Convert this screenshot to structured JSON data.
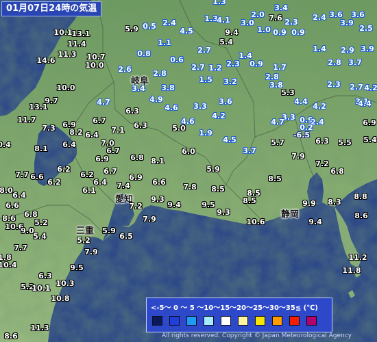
{
  "title": "01月07日24時の気温",
  "prefectures": [
    {
      "id": "gifu",
      "name": "岐阜"
    },
    {
      "id": "aichi",
      "name": "愛知"
    },
    {
      "id": "mie",
      "name": "三重"
    },
    {
      "id": "shizuoka",
      "name": "静岡"
    }
  ],
  "temperatures": [
    {
      "id": "t01",
      "value": "1.3",
      "kind": "cold"
    },
    {
      "id": "t02",
      "value": "2.0",
      "kind": "cold"
    },
    {
      "id": "t03",
      "value": "7.6",
      "kind": "hot"
    },
    {
      "id": "t04",
      "value": "3.4",
      "kind": "cold"
    },
    {
      "id": "t05",
      "value": "2.4",
      "kind": "cold"
    },
    {
      "id": "t06",
      "value": "3.6",
      "kind": "cold"
    },
    {
      "id": "t07",
      "value": "3.9",
      "kind": "cold"
    },
    {
      "id": "t08",
      "value": "3.6",
      "kind": "cold"
    },
    {
      "id": "t09",
      "value": "1.3",
      "kind": "cold"
    },
    {
      "id": "t10",
      "value": "3.0",
      "kind": "cold"
    },
    {
      "id": "t11",
      "value": "2.3",
      "kind": "cold"
    },
    {
      "id": "t12",
      "value": "4.1",
      "kind": "cold"
    },
    {
      "id": "t13",
      "value": "0.5",
      "kind": "cold"
    },
    {
      "id": "t14",
      "value": "2.4",
      "kind": "cold"
    },
    {
      "id": "t15",
      "value": "4.5",
      "kind": "cold"
    },
    {
      "id": "t16",
      "value": "5.9",
      "kind": "hot"
    },
    {
      "id": "t17",
      "value": "1.0",
      "kind": "cold"
    },
    {
      "id": "t18",
      "value": "0.9",
      "kind": "cold"
    },
    {
      "id": "t19",
      "value": "0.9",
      "kind": "cold"
    },
    {
      "id": "t20",
      "value": "2.5",
      "kind": "cold"
    },
    {
      "id": "t21",
      "value": "10.1",
      "kind": "hot"
    },
    {
      "id": "t22",
      "value": "13.1",
      "kind": "hot"
    },
    {
      "id": "t23",
      "value": "1.1",
      "kind": "cold"
    },
    {
      "id": "t24",
      "value": "9.4",
      "kind": "hot"
    },
    {
      "id": "t25",
      "value": "5.4",
      "kind": "hot"
    },
    {
      "id": "t26",
      "value": "1.4",
      "kind": "cold"
    },
    {
      "id": "t27",
      "value": "2.9",
      "kind": "cold"
    },
    {
      "id": "t28",
      "value": "3.9",
      "kind": "cold"
    },
    {
      "id": "t29",
      "value": "11.4",
      "kind": "hot"
    },
    {
      "id": "t30",
      "value": "2.7",
      "kind": "cold"
    },
    {
      "id": "t31",
      "value": "11.3",
      "kind": "hot"
    },
    {
      "id": "t32",
      "value": "10.7",
      "kind": "hot"
    },
    {
      "id": "t33",
      "value": "0.8",
      "kind": "cold"
    },
    {
      "id": "t34",
      "value": "1.4",
      "kind": "cold"
    },
    {
      "id": "t35",
      "value": "14.6",
      "kind": "hot"
    },
    {
      "id": "t36",
      "value": "10.0",
      "kind": "hot"
    },
    {
      "id": "t37",
      "value": "0.6",
      "kind": "cold"
    },
    {
      "id": "t38",
      "value": "2.3",
      "kind": "cold"
    },
    {
      "id": "t39",
      "value": "0.9",
      "kind": "cold"
    },
    {
      "id": "t40",
      "value": "2.8",
      "kind": "cold"
    },
    {
      "id": "t41",
      "value": "3.7",
      "kind": "cold"
    },
    {
      "id": "t42",
      "value": "2.6",
      "kind": "cold"
    },
    {
      "id": "t43",
      "value": "2.7",
      "kind": "cold"
    },
    {
      "id": "t44",
      "value": "1.2",
      "kind": "cold"
    },
    {
      "id": "t45",
      "value": "1.7",
      "kind": "cold"
    },
    {
      "id": "t46",
      "value": "2.8",
      "kind": "cold"
    },
    {
      "id": "t47",
      "value": "2.8",
      "kind": "cold"
    },
    {
      "id": "t48",
      "value": "1.5",
      "kind": "cold"
    },
    {
      "id": "t49",
      "value": "3.2",
      "kind": "cold"
    },
    {
      "id": "t50",
      "value": "2.3",
      "kind": "cold"
    },
    {
      "id": "t51",
      "value": "2.7",
      "kind": "cold"
    },
    {
      "id": "t52",
      "value": "3.4",
      "kind": "cold"
    },
    {
      "id": "t53",
      "value": "3.8",
      "kind": "cold"
    },
    {
      "id": "t54",
      "value": "3.8",
      "kind": "cold"
    },
    {
      "id": "t55",
      "value": "10.0",
      "kind": "hot"
    },
    {
      "id": "t56",
      "value": "5.3",
      "kind": "hot"
    },
    {
      "id": "t57",
      "value": "4.2",
      "kind": "cold"
    },
    {
      "id": "t58",
      "value": "3.1",
      "kind": "cold"
    },
    {
      "id": "t59",
      "value": "9.7",
      "kind": "hot"
    },
    {
      "id": "t60",
      "value": "4.7",
      "kind": "cold"
    },
    {
      "id": "t61",
      "value": "4.9",
      "kind": "cold"
    },
    {
      "id": "t62",
      "value": "4.6",
      "kind": "cold"
    },
    {
      "id": "t63",
      "value": "3.3",
      "kind": "cold"
    },
    {
      "id": "t64",
      "value": "3.6",
      "kind": "cold"
    },
    {
      "id": "t65",
      "value": "4.4",
      "kind": "cold"
    },
    {
      "id": "t66",
      "value": "4.2",
      "kind": "cold"
    },
    {
      "id": "t67",
      "value": "4.4",
      "kind": "cold"
    },
    {
      "id": "t68",
      "value": "13.1",
      "kind": "hot"
    },
    {
      "id": "t69",
      "value": "6.3",
      "kind": "hot"
    },
    {
      "id": "t70",
      "value": "4.2",
      "kind": "cold"
    },
    {
      "id": "t71",
      "value": "3.3",
      "kind": "cold"
    },
    {
      "id": "t72",
      "value": "0.9",
      "kind": "cold"
    },
    {
      "id": "t73",
      "value": "2.4",
      "kind": "cold"
    },
    {
      "id": "t74",
      "value": "11.7",
      "kind": "hot"
    },
    {
      "id": "t75",
      "value": "6.7",
      "kind": "hot"
    },
    {
      "id": "t76",
      "value": "4.6",
      "kind": "cold"
    },
    {
      "id": "t77",
      "value": "4.7",
      "kind": "cold"
    },
    {
      "id": "t78",
      "value": "0.2",
      "kind": "cold"
    },
    {
      "id": "t79",
      "value": "6.3",
      "kind": "hot"
    },
    {
      "id": "t80",
      "value": "6.9",
      "kind": "hot"
    },
    {
      "id": "t81",
      "value": "7.3",
      "kind": "hot"
    },
    {
      "id": "t82",
      "value": "7.1",
      "kind": "hot"
    },
    {
      "id": "t83",
      "value": "5.0",
      "kind": "hot"
    },
    {
      "id": "t84",
      "value": "8.2",
      "kind": "hot"
    },
    {
      "id": "t85",
      "value": "6.4",
      "kind": "hot"
    },
    {
      "id": "t86",
      "value": "1.9",
      "kind": "cold"
    },
    {
      "id": "t87",
      "value": "-6.5",
      "kind": "neg"
    },
    {
      "id": "t88",
      "value": "6.9",
      "kind": "hot"
    },
    {
      "id": "t89",
      "value": "4.5",
      "kind": "cold"
    },
    {
      "id": "t90",
      "value": "6.3",
      "kind": "hot"
    },
    {
      "id": "t91",
      "value": "5.5",
      "kind": "hot"
    },
    {
      "id": "t92",
      "value": "0.4",
      "kind": "hot"
    },
    {
      "id": "t93",
      "value": "7.0",
      "kind": "hot"
    },
    {
      "id": "t94",
      "value": "6.4",
      "kind": "hot"
    },
    {
      "id": "t95",
      "value": "5.7",
      "kind": "hot"
    },
    {
      "id": "t96",
      "value": "5.4",
      "kind": "hot"
    },
    {
      "id": "t97",
      "value": "8.1",
      "kind": "hot"
    },
    {
      "id": "t98",
      "value": "6.7",
      "kind": "hot"
    },
    {
      "id": "t99",
      "value": "6.0",
      "kind": "hot"
    },
    {
      "id": "t100",
      "value": "3.7",
      "kind": "cold"
    },
    {
      "id": "t101",
      "value": "6.8",
      "kind": "hot"
    },
    {
      "id": "t102",
      "value": "8.1",
      "kind": "hot"
    },
    {
      "id": "t103",
      "value": "7.9",
      "kind": "hot"
    },
    {
      "id": "t104",
      "value": "6.9",
      "kind": "hot"
    },
    {
      "id": "t105",
      "value": "7.2",
      "kind": "hot"
    },
    {
      "id": "t106",
      "value": "6.2",
      "kind": "hot"
    },
    {
      "id": "t107",
      "value": "6.7",
      "kind": "hot"
    },
    {
      "id": "t108",
      "value": "5.9",
      "kind": "hot"
    },
    {
      "id": "t109",
      "value": "6.8",
      "kind": "hot"
    },
    {
      "id": "t110",
      "value": "7.7",
      "kind": "hot"
    },
    {
      "id": "t111",
      "value": "6.6",
      "kind": "hot"
    },
    {
      "id": "t112",
      "value": "6.2",
      "kind": "hot"
    },
    {
      "id": "t113",
      "value": "6.9",
      "kind": "hot"
    },
    {
      "id": "t114",
      "value": "6.4",
      "kind": "hot"
    },
    {
      "id": "t115",
      "value": "6.6",
      "kind": "hot"
    },
    {
      "id": "t116",
      "value": "8.5",
      "kind": "hot"
    },
    {
      "id": "t117",
      "value": "6.2",
      "kind": "hot"
    },
    {
      "id": "t118",
      "value": "6.1",
      "kind": "hot"
    },
    {
      "id": "t119",
      "value": "7.4",
      "kind": "hot"
    },
    {
      "id": "t120",
      "value": "7.8",
      "kind": "hot"
    },
    {
      "id": "t121",
      "value": "8.5",
      "kind": "hot"
    },
    {
      "id": "t122",
      "value": "8.0",
      "kind": "hot"
    },
    {
      "id": "t123",
      "value": "8.5",
      "kind": "hot"
    },
    {
      "id": "t124",
      "value": "9.9",
      "kind": "hot"
    },
    {
      "id": "t125",
      "value": "8.8",
      "kind": "hot"
    },
    {
      "id": "t126",
      "value": "6.4",
      "kind": "hot"
    },
    {
      "id": "t127",
      "value": "7.2",
      "kind": "hot"
    },
    {
      "id": "t128",
      "value": "9.3",
      "kind": "hot"
    },
    {
      "id": "t129",
      "value": "9.4",
      "kind": "hot"
    },
    {
      "id": "t130",
      "value": "9.5",
      "kind": "hot"
    },
    {
      "id": "t131",
      "value": "8.5",
      "kind": "hot"
    },
    {
      "id": "t132",
      "value": "8.3",
      "kind": "hot"
    },
    {
      "id": "t133",
      "value": "10.6",
      "kind": "hot"
    },
    {
      "id": "t134",
      "value": "6.6",
      "kind": "hot"
    },
    {
      "id": "t135",
      "value": "6.8",
      "kind": "hot"
    },
    {
      "id": "t136",
      "value": "9.3",
      "kind": "hot"
    },
    {
      "id": "t137",
      "value": "8.6",
      "kind": "hot"
    },
    {
      "id": "t138",
      "value": "8.6",
      "kind": "hot"
    },
    {
      "id": "t139",
      "value": "5.2",
      "kind": "hot"
    },
    {
      "id": "t140",
      "value": "7.9",
      "kind": "hot"
    },
    {
      "id": "t141",
      "value": "9.4",
      "kind": "hot"
    },
    {
      "id": "t142",
      "value": "10.6",
      "kind": "hot"
    },
    {
      "id": "t143",
      "value": "5.9",
      "kind": "hot"
    },
    {
      "id": "t144",
      "value": "6.5",
      "kind": "hot"
    },
    {
      "id": "t145",
      "value": "9.0",
      "kind": "hot"
    },
    {
      "id": "t146",
      "value": "5.2",
      "kind": "hot"
    },
    {
      "id": "t147",
      "value": "5.4",
      "kind": "hot"
    },
    {
      "id": "t148",
      "value": "7.9",
      "kind": "hot"
    },
    {
      "id": "t149",
      "value": "7.7",
      "kind": "hot"
    },
    {
      "id": "t150",
      "value": "11.2",
      "kind": "hot"
    },
    {
      "id": "t151",
      "value": "1.8",
      "kind": "hot"
    },
    {
      "id": "t152",
      "value": "10.4",
      "kind": "hot"
    },
    {
      "id": "t153",
      "value": "9.5",
      "kind": "hot"
    },
    {
      "id": "t154",
      "value": "11.8",
      "kind": "hot"
    },
    {
      "id": "t155",
      "value": "6.3",
      "kind": "hot"
    },
    {
      "id": "t156",
      "value": "5.2",
      "kind": "hot"
    },
    {
      "id": "t157",
      "value": "10.3",
      "kind": "hot"
    },
    {
      "id": "t158",
      "value": "10.1",
      "kind": "hot"
    },
    {
      "id": "t159",
      "value": "10.8",
      "kind": "hot"
    },
    {
      "id": "t160",
      "value": "11.3",
      "kind": "hot"
    },
    {
      "id": "t161",
      "value": "8.6",
      "kind": "hot"
    }
  ],
  "legend": {
    "range_text": "<-5〜 0 〜 5 〜10〜15〜20〜25〜30〜35≦ (℃)",
    "swatch_colors": [
      "#0a1a5a",
      "#1f3fd8",
      "#1e9cf5",
      "#a6ecff",
      "#ffffff",
      "#fff5a0",
      "#f5e400",
      "#ff9c00",
      "#f51e00",
      "#b4006e"
    ]
  },
  "copyright": "All rights reserved. Copyright © Japan Meteorological Agency"
}
